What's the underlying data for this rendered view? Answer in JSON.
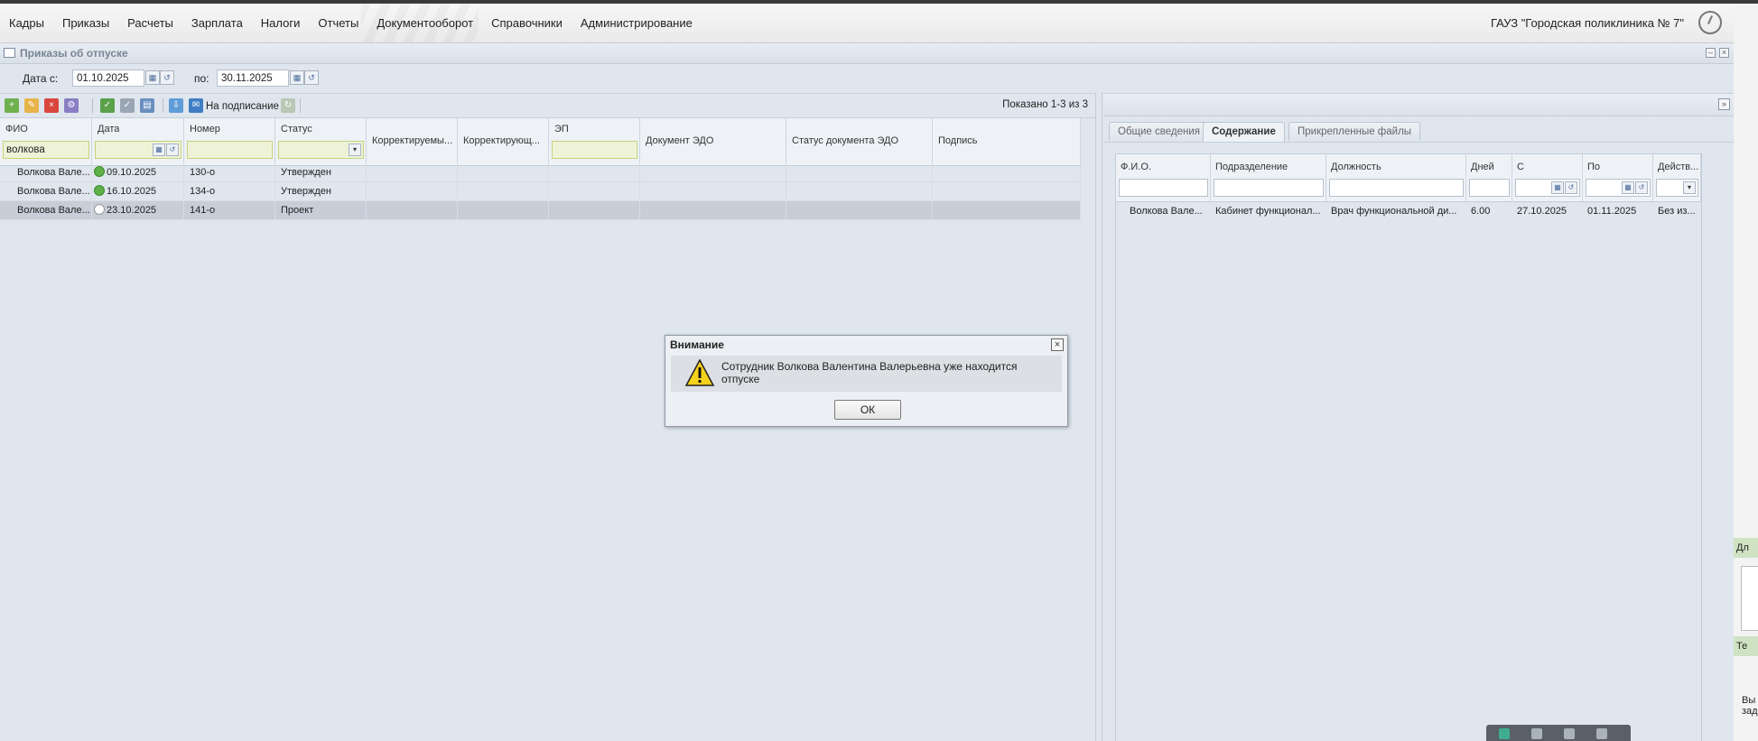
{
  "menu": {
    "items": [
      "Кадры",
      "Приказы",
      "Расчеты",
      "Зарплата",
      "Налоги",
      "Отчеты",
      "Документооборот",
      "Справочники",
      "Администрирование"
    ],
    "org_name": "ГАУЗ \"Городская поликлиника № 7\""
  },
  "panel": {
    "title": "Приказы об отпуске"
  },
  "dates": {
    "from_label": "Дата с:",
    "from_value": "01.10.2025",
    "to_label": "по:",
    "to_value": "30.11.2025"
  },
  "toolbar": {
    "sign_label": "На подписание",
    "count_text": "Показано 1-3 из 3"
  },
  "grid": {
    "columns": [
      "ФИО",
      "Дата",
      "Номер",
      "Статус",
      "Корректируемы...",
      "Корректирующ...",
      "ЭП",
      "Документ ЭДО",
      "Статус документа ЭДО",
      "Подпись"
    ],
    "filter_fio": "волкова",
    "rows": [
      {
        "fio": "Волкова Вале...",
        "date": "09.10.2025",
        "number": "130-о",
        "status": "Утвержден",
        "icon": "check-circle-icon"
      },
      {
        "fio": "Волкова Вале...",
        "date": "16.10.2025",
        "number": "134-о",
        "status": "Утвержден",
        "icon": "check-circle-icon"
      },
      {
        "fio": "Волкова Вале...",
        "date": "23.10.2025",
        "number": "141-о",
        "status": "Проект",
        "icon": "clock-icon"
      }
    ]
  },
  "tabs": [
    "Общие сведения",
    "Содержание",
    "Прикрепленные файлы"
  ],
  "right_grid": {
    "columns": [
      "Ф.И.О.",
      "Подразделение",
      "Должность",
      "Дней",
      "С",
      "По",
      "Действ..."
    ],
    "row": {
      "fio": "Волкова Вале...",
      "dept": "Кабинет функционал...",
      "position": "Врач функциональной ди...",
      "days": "6.00",
      "from": "27.10.2025",
      "to": "01.11.2025",
      "action": "Без из..."
    }
  },
  "dialog": {
    "title": "Внимание",
    "message": "Сотрудник Волкова Валентина Валерьевна уже находится отпуске",
    "ok_label": "ОК"
  },
  "side_strip": {
    "label1": "Дл",
    "label2": "Те",
    "text1": "Вы",
    "text2": "зад"
  }
}
